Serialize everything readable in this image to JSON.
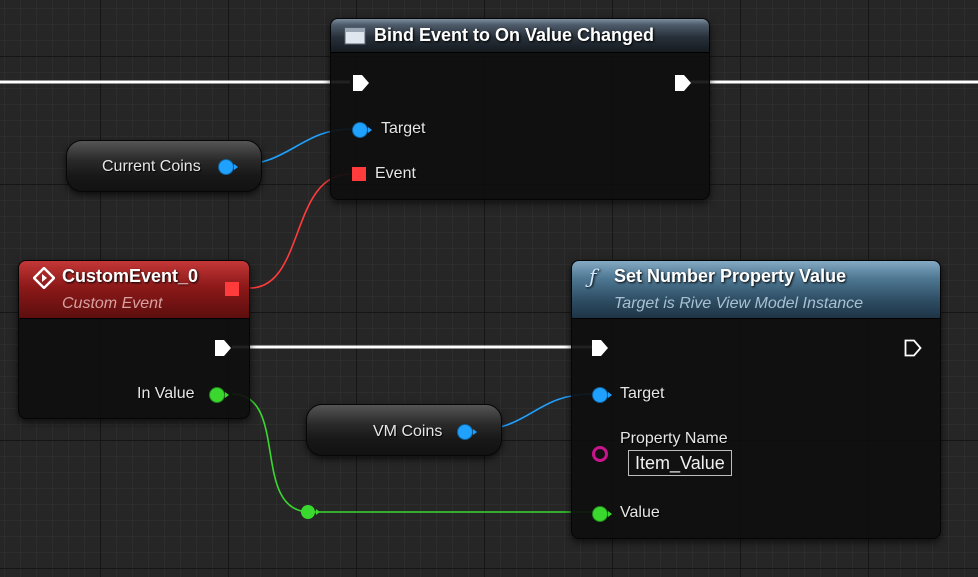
{
  "nodes": {
    "bind_event": {
      "title": "Bind Event to On Value Changed",
      "pins": {
        "target": "Target",
        "event": "Event"
      }
    },
    "current_coins": {
      "label": "Current Coins"
    },
    "custom_event": {
      "title": "CustomEvent_0",
      "subtitle": "Custom Event",
      "pins": {
        "in_value": "In Value"
      }
    },
    "set_number": {
      "title": "Set Number Property Value",
      "subtitle": "Target is Rive View Model Instance",
      "pins": {
        "target": "Target",
        "property_name": "Property Name",
        "property_value": "Item_Value",
        "value": "Value"
      }
    },
    "vm_coins": {
      "label": "VM Coins"
    }
  },
  "colors": {
    "exec_wire": "#ffffff",
    "object_pin": "#1fa1ff",
    "delegate_pin": "#ff3b3b",
    "float_pin": "#3ad82f",
    "name_pin": "#c8158c",
    "event_header": "#8d1919",
    "function_header": "#4f7893"
  },
  "icons": [
    "delegate-icon",
    "event-diamond-icon",
    "function-icon",
    "exec-arrow-icon"
  ]
}
